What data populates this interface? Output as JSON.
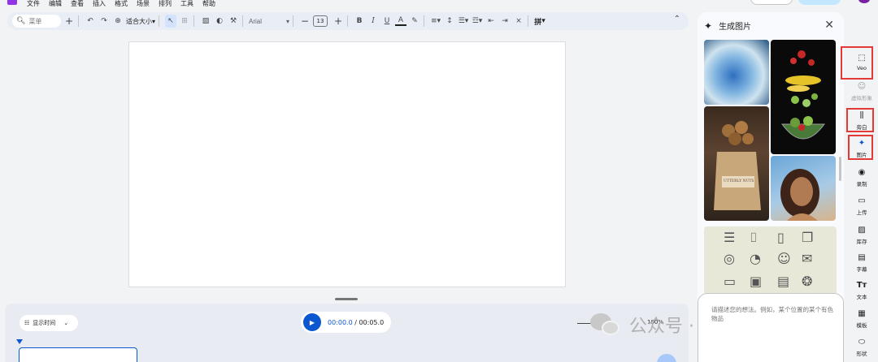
{
  "menu": [
    "文件",
    "编辑",
    "查看",
    "插入",
    "格式",
    "场景",
    "排列",
    "工具",
    "帮助"
  ],
  "toolbar": {
    "search_placeholder": "菜单",
    "fit_label": "适合大小",
    "font": "Arial",
    "font_size": "13",
    "input_method": "拼"
  },
  "timeline": {
    "show_time_label": "显示时间",
    "current_time": "00:00.0",
    "separator": " / ",
    "total_time": "00:05.0",
    "zoom": "100%"
  },
  "panel": {
    "title": "生成图片",
    "thumb_text": "UTTERLY NUTS",
    "prompt_placeholder": "请描述您的想法。例如，某个位置的某个有色物品"
  },
  "rail": [
    {
      "label": "Veo",
      "icon": "veo-icon",
      "highlighted": true,
      "disabled": false
    },
    {
      "label": "虚拟形象",
      "icon": "avatar-icon",
      "highlighted": false,
      "disabled": true
    },
    {
      "label": "旁白",
      "icon": "voiceover-icon",
      "highlighted": true,
      "disabled": false
    },
    {
      "label": "图片",
      "icon": "image-sparkle-icon",
      "highlighted": true,
      "disabled": false
    },
    {
      "label": "录制",
      "icon": "record-icon",
      "highlighted": false,
      "disabled": false
    },
    {
      "label": "上传",
      "icon": "folder-icon",
      "highlighted": false,
      "disabled": false
    },
    {
      "label": "库存",
      "icon": "stock-icon",
      "highlighted": false,
      "disabled": false
    },
    {
      "label": "字幕",
      "icon": "subtitles-icon",
      "highlighted": false,
      "disabled": false
    },
    {
      "label": "文本",
      "icon": "text-icon",
      "highlighted": false,
      "disabled": false
    },
    {
      "label": "模板",
      "icon": "template-icon",
      "highlighted": false,
      "disabled": false
    },
    {
      "label": "形状",
      "icon": "shapes-icon",
      "highlighted": false,
      "disabled": false
    }
  ],
  "watermark": "公众号 · 船长AI视界",
  "colors": {
    "accent": "#0b57d0",
    "highlight_box": "#e53935",
    "logo": "#9334e6"
  }
}
